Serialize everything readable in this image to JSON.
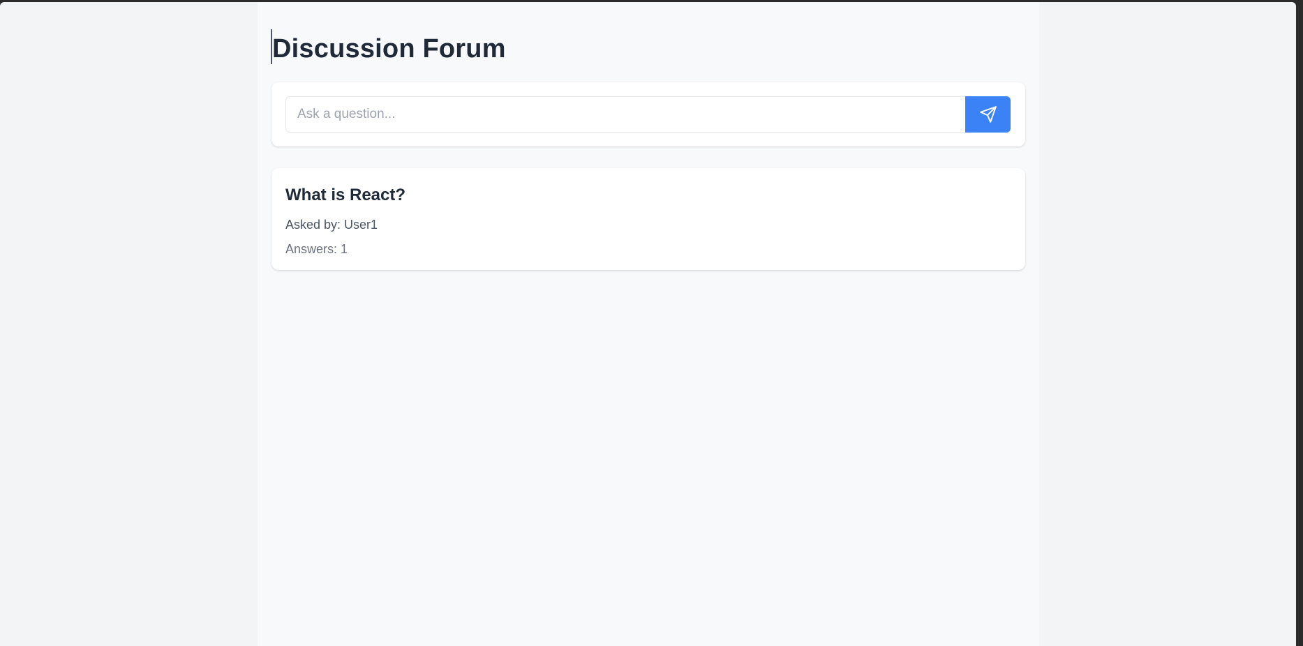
{
  "page": {
    "title": "Discussion Forum"
  },
  "ask": {
    "placeholder": "Ask a question...",
    "value": "",
    "send_icon": "send-icon"
  },
  "questions": [
    {
      "title": "What is React?",
      "asked_by": "Asked by: User1",
      "answers": "Answers: 1"
    }
  ],
  "colors": {
    "accent": "#3b82f6",
    "title_text": "#1f2937",
    "muted_text": "#4b5563",
    "page_bg": "#f8f9fb",
    "card_bg": "#ffffff"
  }
}
